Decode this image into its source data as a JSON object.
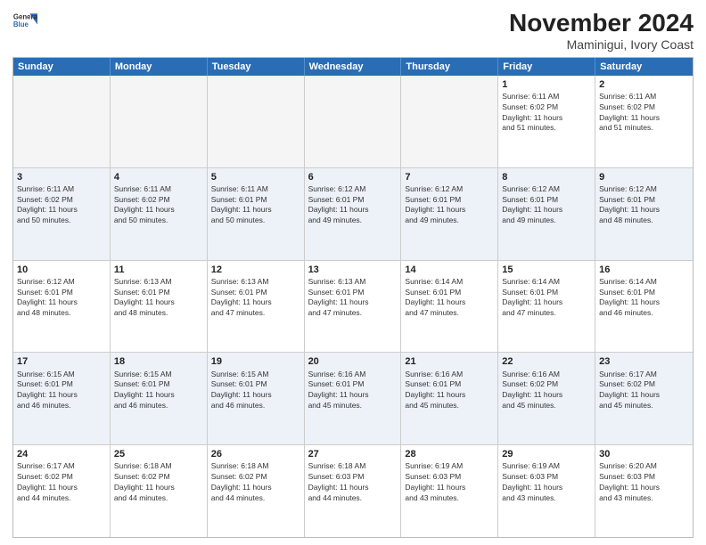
{
  "header": {
    "logo": {
      "line1": "General",
      "line2": "Blue"
    },
    "title": "November 2024",
    "subtitle": "Maminigui, Ivory Coast"
  },
  "days_of_week": [
    "Sunday",
    "Monday",
    "Tuesday",
    "Wednesday",
    "Thursday",
    "Friday",
    "Saturday"
  ],
  "weeks": [
    [
      {
        "day": "",
        "info": "",
        "empty": true
      },
      {
        "day": "",
        "info": "",
        "empty": true
      },
      {
        "day": "",
        "info": "",
        "empty": true
      },
      {
        "day": "",
        "info": "",
        "empty": true
      },
      {
        "day": "",
        "info": "",
        "empty": true
      },
      {
        "day": "1",
        "info": "Sunrise: 6:11 AM\nSunset: 6:02 PM\nDaylight: 11 hours\nand 51 minutes.",
        "empty": false
      },
      {
        "day": "2",
        "info": "Sunrise: 6:11 AM\nSunset: 6:02 PM\nDaylight: 11 hours\nand 51 minutes.",
        "empty": false
      }
    ],
    [
      {
        "day": "3",
        "info": "Sunrise: 6:11 AM\nSunset: 6:02 PM\nDaylight: 11 hours\nand 50 minutes.",
        "empty": false
      },
      {
        "day": "4",
        "info": "Sunrise: 6:11 AM\nSunset: 6:02 PM\nDaylight: 11 hours\nand 50 minutes.",
        "empty": false
      },
      {
        "day": "5",
        "info": "Sunrise: 6:11 AM\nSunset: 6:01 PM\nDaylight: 11 hours\nand 50 minutes.",
        "empty": false
      },
      {
        "day": "6",
        "info": "Sunrise: 6:12 AM\nSunset: 6:01 PM\nDaylight: 11 hours\nand 49 minutes.",
        "empty": false
      },
      {
        "day": "7",
        "info": "Sunrise: 6:12 AM\nSunset: 6:01 PM\nDaylight: 11 hours\nand 49 minutes.",
        "empty": false
      },
      {
        "day": "8",
        "info": "Sunrise: 6:12 AM\nSunset: 6:01 PM\nDaylight: 11 hours\nand 49 minutes.",
        "empty": false
      },
      {
        "day": "9",
        "info": "Sunrise: 6:12 AM\nSunset: 6:01 PM\nDaylight: 11 hours\nand 48 minutes.",
        "empty": false
      }
    ],
    [
      {
        "day": "10",
        "info": "Sunrise: 6:12 AM\nSunset: 6:01 PM\nDaylight: 11 hours\nand 48 minutes.",
        "empty": false
      },
      {
        "day": "11",
        "info": "Sunrise: 6:13 AM\nSunset: 6:01 PM\nDaylight: 11 hours\nand 48 minutes.",
        "empty": false
      },
      {
        "day": "12",
        "info": "Sunrise: 6:13 AM\nSunset: 6:01 PM\nDaylight: 11 hours\nand 47 minutes.",
        "empty": false
      },
      {
        "day": "13",
        "info": "Sunrise: 6:13 AM\nSunset: 6:01 PM\nDaylight: 11 hours\nand 47 minutes.",
        "empty": false
      },
      {
        "day": "14",
        "info": "Sunrise: 6:14 AM\nSunset: 6:01 PM\nDaylight: 11 hours\nand 47 minutes.",
        "empty": false
      },
      {
        "day": "15",
        "info": "Sunrise: 6:14 AM\nSunset: 6:01 PM\nDaylight: 11 hours\nand 47 minutes.",
        "empty": false
      },
      {
        "day": "16",
        "info": "Sunrise: 6:14 AM\nSunset: 6:01 PM\nDaylight: 11 hours\nand 46 minutes.",
        "empty": false
      }
    ],
    [
      {
        "day": "17",
        "info": "Sunrise: 6:15 AM\nSunset: 6:01 PM\nDaylight: 11 hours\nand 46 minutes.",
        "empty": false
      },
      {
        "day": "18",
        "info": "Sunrise: 6:15 AM\nSunset: 6:01 PM\nDaylight: 11 hours\nand 46 minutes.",
        "empty": false
      },
      {
        "day": "19",
        "info": "Sunrise: 6:15 AM\nSunset: 6:01 PM\nDaylight: 11 hours\nand 46 minutes.",
        "empty": false
      },
      {
        "day": "20",
        "info": "Sunrise: 6:16 AM\nSunset: 6:01 PM\nDaylight: 11 hours\nand 45 minutes.",
        "empty": false
      },
      {
        "day": "21",
        "info": "Sunrise: 6:16 AM\nSunset: 6:01 PM\nDaylight: 11 hours\nand 45 minutes.",
        "empty": false
      },
      {
        "day": "22",
        "info": "Sunrise: 6:16 AM\nSunset: 6:02 PM\nDaylight: 11 hours\nand 45 minutes.",
        "empty": false
      },
      {
        "day": "23",
        "info": "Sunrise: 6:17 AM\nSunset: 6:02 PM\nDaylight: 11 hours\nand 45 minutes.",
        "empty": false
      }
    ],
    [
      {
        "day": "24",
        "info": "Sunrise: 6:17 AM\nSunset: 6:02 PM\nDaylight: 11 hours\nand 44 minutes.",
        "empty": false
      },
      {
        "day": "25",
        "info": "Sunrise: 6:18 AM\nSunset: 6:02 PM\nDaylight: 11 hours\nand 44 minutes.",
        "empty": false
      },
      {
        "day": "26",
        "info": "Sunrise: 6:18 AM\nSunset: 6:02 PM\nDaylight: 11 hours\nand 44 minutes.",
        "empty": false
      },
      {
        "day": "27",
        "info": "Sunrise: 6:18 AM\nSunset: 6:03 PM\nDaylight: 11 hours\nand 44 minutes.",
        "empty": false
      },
      {
        "day": "28",
        "info": "Sunrise: 6:19 AM\nSunset: 6:03 PM\nDaylight: 11 hours\nand 43 minutes.",
        "empty": false
      },
      {
        "day": "29",
        "info": "Sunrise: 6:19 AM\nSunset: 6:03 PM\nDaylight: 11 hours\nand 43 minutes.",
        "empty": false
      },
      {
        "day": "30",
        "info": "Sunrise: 6:20 AM\nSunset: 6:03 PM\nDaylight: 11 hours\nand 43 minutes.",
        "empty": false
      }
    ]
  ]
}
